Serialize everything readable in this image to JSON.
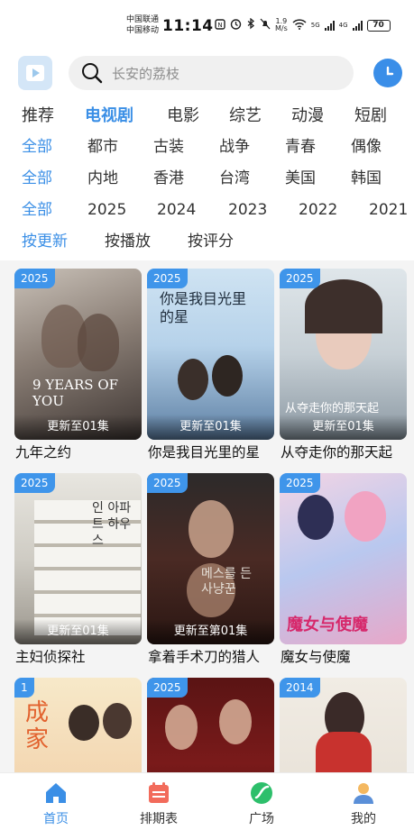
{
  "status": {
    "carrier1": "中国联通",
    "carrier2": "中国移动",
    "time": "11:14",
    "net_speed_value": "1.9",
    "net_speed_unit": "M/s",
    "net1": "5G",
    "net2": "4G",
    "battery": "70"
  },
  "header": {
    "search_placeholder": "长安的荔枝",
    "logo_icon": "play-logo-icon",
    "history_icon": "clock-icon"
  },
  "tabs": [
    {
      "label": "推荐",
      "active": false
    },
    {
      "label": "电视剧",
      "active": true
    },
    {
      "label": "电影",
      "active": false
    },
    {
      "label": "综艺",
      "active": false
    },
    {
      "label": "动漫",
      "active": false
    },
    {
      "label": "短剧",
      "active": false
    }
  ],
  "filters": {
    "genre": [
      "全部",
      "都市",
      "古装",
      "战争",
      "青春",
      "偶像"
    ],
    "region": [
      "全部",
      "内地",
      "香港",
      "台湾",
      "美国",
      "韩国"
    ],
    "year": [
      "全部",
      "2025",
      "2024",
      "2023",
      "2022",
      "2021"
    ],
    "sort": [
      "按更新",
      "按播放",
      "按评分"
    ]
  },
  "cards": [
    {
      "year": "2025",
      "update": "更新至01集",
      "title": "九年之约",
      "poster_text": "9 YEARS OF YOU"
    },
    {
      "year": "2025",
      "update": "更新至01集",
      "title": "你是我目光里的星",
      "poster_text": "你是我目光里的星"
    },
    {
      "year": "2025",
      "update": "更新至01集",
      "title": "从夺走你的那天起",
      "poster_text": "从夺走你的那天起"
    },
    {
      "year": "2025",
      "update": "更新至01集",
      "title": "主妇侦探社",
      "poster_text": "인 아파트 하우스"
    },
    {
      "year": "2025",
      "update": "更新至第01集",
      "title": "拿着手术刀的猎人",
      "poster_text": "메스를 든 사냥꾼"
    },
    {
      "year": "2025",
      "update": "",
      "title": "魔女与使魔",
      "poster_text": "魔女与使魔"
    },
    {
      "year": "1",
      "update": "",
      "title": "",
      "poster_text": "成家"
    },
    {
      "year": "2025",
      "update": "",
      "title": "",
      "poster_text": ""
    },
    {
      "year": "2014",
      "update": "",
      "title": "",
      "poster_text": ""
    }
  ],
  "nav": [
    {
      "label": "首页",
      "icon": "home-icon",
      "active": true
    },
    {
      "label": "排期表",
      "icon": "calendar-icon",
      "active": false
    },
    {
      "label": "广场",
      "icon": "plaza-icon",
      "active": false
    },
    {
      "label": "我的",
      "icon": "user-icon",
      "active": false
    }
  ],
  "colors": {
    "accent": "#3b8fe6",
    "badge": "#3f95ea",
    "calendar": "#f26b5b",
    "plaza": "#2dbf6b"
  }
}
